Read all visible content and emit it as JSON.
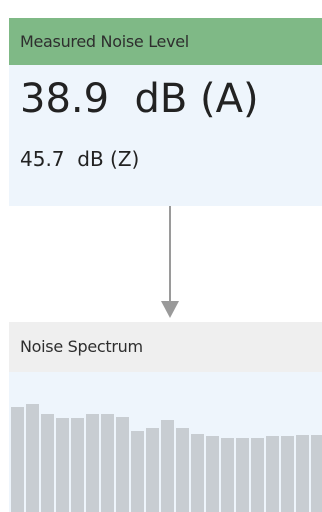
{
  "noise_level": {
    "title": "Measured Noise Level",
    "a_weighted": "38.9  dB (A)",
    "z_weighted": "45.7  dB (Z)"
  },
  "spectrum": {
    "title": "Noise Spectrum",
    "bar_color": "#c8cdd2",
    "levels": [
      0.75,
      0.77,
      0.7,
      0.67,
      0.67,
      0.7,
      0.7,
      0.68,
      0.58,
      0.6,
      0.66,
      0.6,
      0.56,
      0.54,
      0.53,
      0.53,
      0.53,
      0.54,
      0.54,
      0.55,
      0.55
    ]
  },
  "colors": {
    "noise_header_bg": "#7fb986",
    "card_body_bg": "#eef5fc",
    "spectrum_header_bg": "#efefef",
    "arrow": "#9a9a9a"
  },
  "icons": {
    "flow": "arrow-down-icon"
  }
}
